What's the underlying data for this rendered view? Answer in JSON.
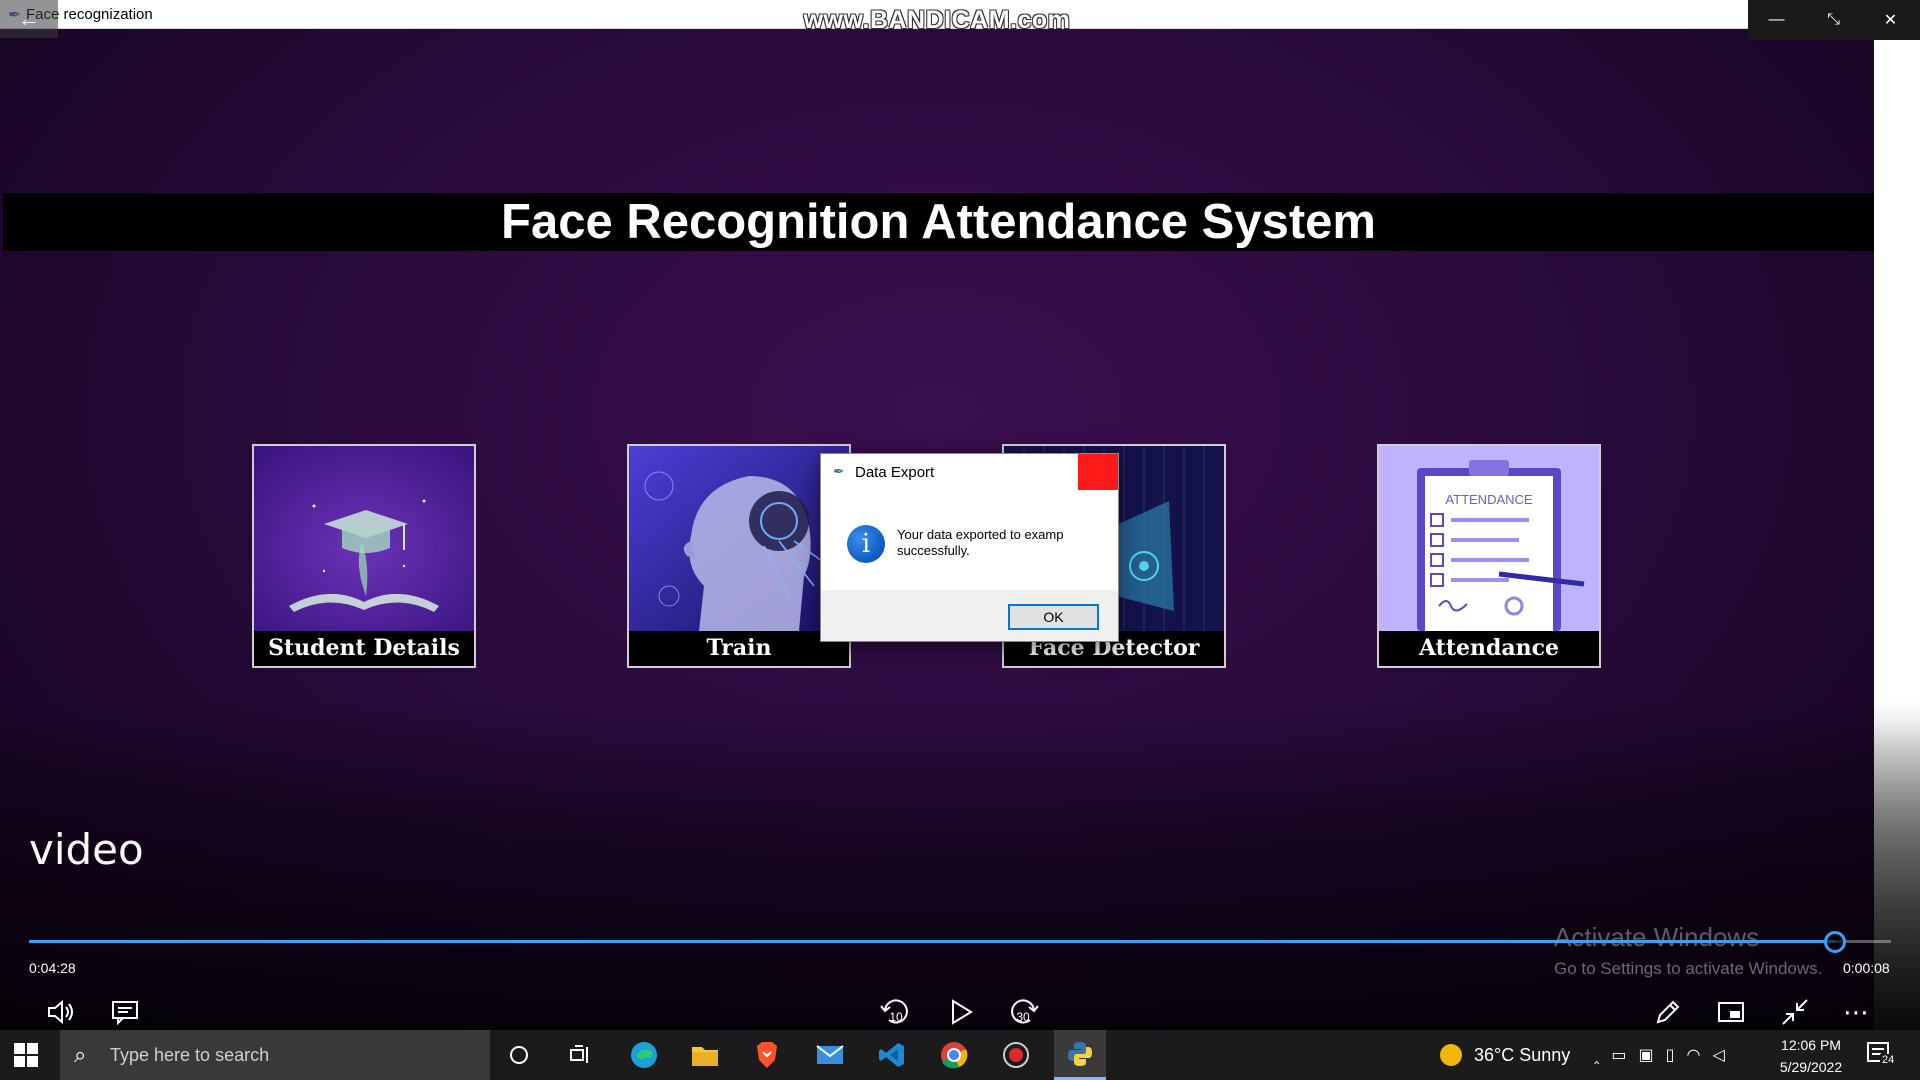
{
  "window": {
    "title": "Face recognization",
    "watermark": "www.BANDICAM.com"
  },
  "banner": {
    "title": "Face Recognition Attendance System"
  },
  "tiles": [
    {
      "label": "Student Details"
    },
    {
      "label": "Train"
    },
    {
      "label": "Face Detector"
    },
    {
      "label": "Attendance"
    }
  ],
  "attendance_sheet_text": "ATTENDANCE",
  "dialog": {
    "title": "Data Export",
    "message": "Your data exported to examp successfully.",
    "ok_label": "OK"
  },
  "player": {
    "video_title": "video",
    "elapsed": "0:04:28",
    "remaining": "0:00:08",
    "progress_fraction": 0.97,
    "skip_back_label": "10",
    "skip_forward_label": "30",
    "activate_title": "Activate Windows",
    "activate_sub": "Go to Settings to activate Windows.",
    "accent_color": "#3aa0ff"
  },
  "taskbar": {
    "search_placeholder": "Type here to search",
    "weather": "36°C  Sunny",
    "time": "12:06 PM",
    "date": "5/29/2022",
    "notification_count": "24"
  }
}
